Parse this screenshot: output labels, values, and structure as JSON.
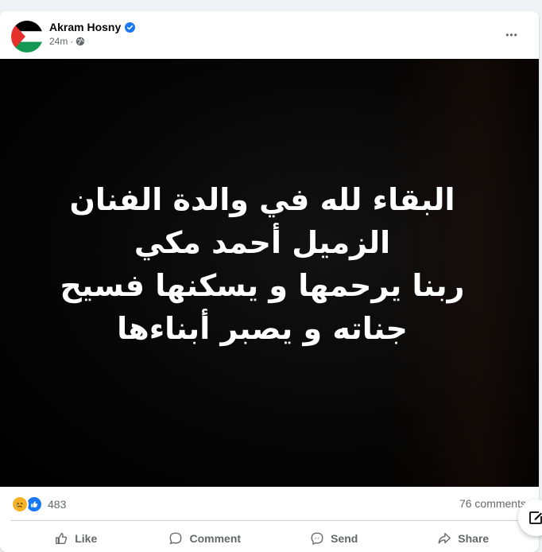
{
  "post": {
    "author": "Akram Hosny",
    "time": "24m",
    "meta_separator": "·",
    "more_label": "•••",
    "image_text": [
      "البقاء لله في والدة الفنان",
      "الزميل أحمد مكي",
      "ربنا يرحمها و يسكنها فسيح",
      "جناته و يصبر أبناءها"
    ],
    "reaction_count": "483",
    "comments_label": "76 comments"
  },
  "actions": {
    "like": "Like",
    "comment": "Comment",
    "send": "Send",
    "share": "Share"
  },
  "icons": {
    "verified": "verified-badge-icon",
    "privacy": "globe-icon",
    "reaction_1": "sad-reaction-icon",
    "reaction_2": "like-reaction-icon",
    "compose": "compose-icon"
  },
  "colors": {
    "accent": "#1877f2",
    "secondary_text": "#65676b",
    "flag_red": "#e4312b",
    "flag_green": "#149954"
  }
}
